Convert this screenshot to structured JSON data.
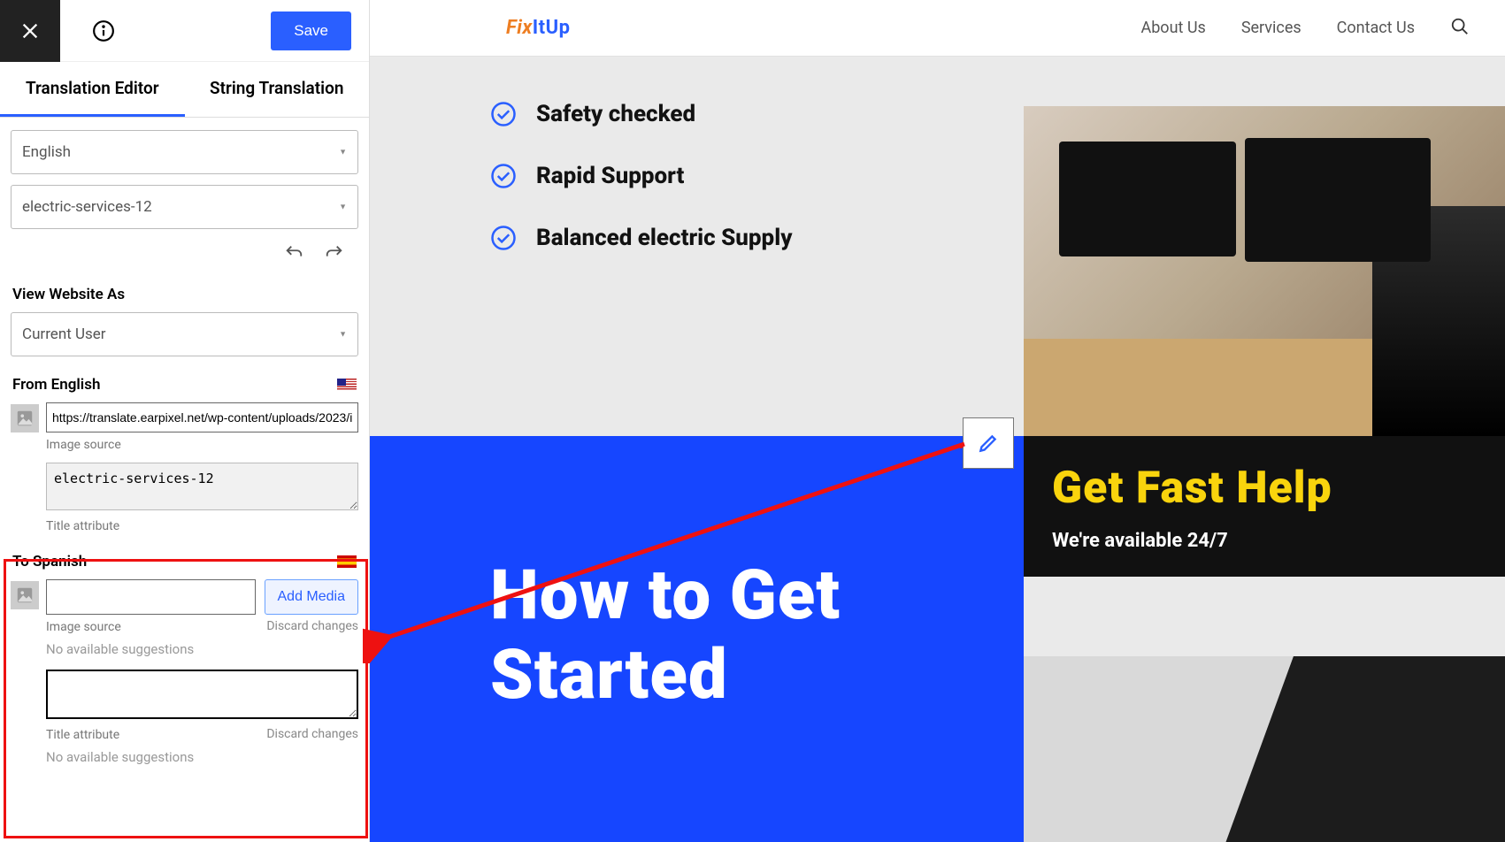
{
  "top": {
    "save_label": "Save"
  },
  "tabs": {
    "editor": "Translation Editor",
    "string": "String Translation"
  },
  "selects": {
    "language": "English",
    "item": "electric-services-12",
    "view_label": "View Website As",
    "view_value": "Current User"
  },
  "from": {
    "label": "From English",
    "image_source_value": "https://translate.earpixel.net/wp-content/uploads/2023/i",
    "image_source_caption": "Image source",
    "title_value": "electric-services-12",
    "title_caption": "Title attribute"
  },
  "to": {
    "label": "To Spanish",
    "add_media_label": "Add Media",
    "image_source_caption": "Image source",
    "discard_label": "Discard changes",
    "no_suggestions": "No available suggestions",
    "title_caption": "Title attribute"
  },
  "site": {
    "logo1": "Fix",
    "logo2": "ItUp",
    "nav": {
      "about": "About Us",
      "services": "Services",
      "contact": "Contact Us"
    },
    "checks": [
      "Safety checked",
      "Rapid Support",
      "Balanced electric Supply"
    ],
    "help_title": "Get Fast Help",
    "help_sub": "We're available 24/7",
    "howto": "How to Get Started"
  }
}
